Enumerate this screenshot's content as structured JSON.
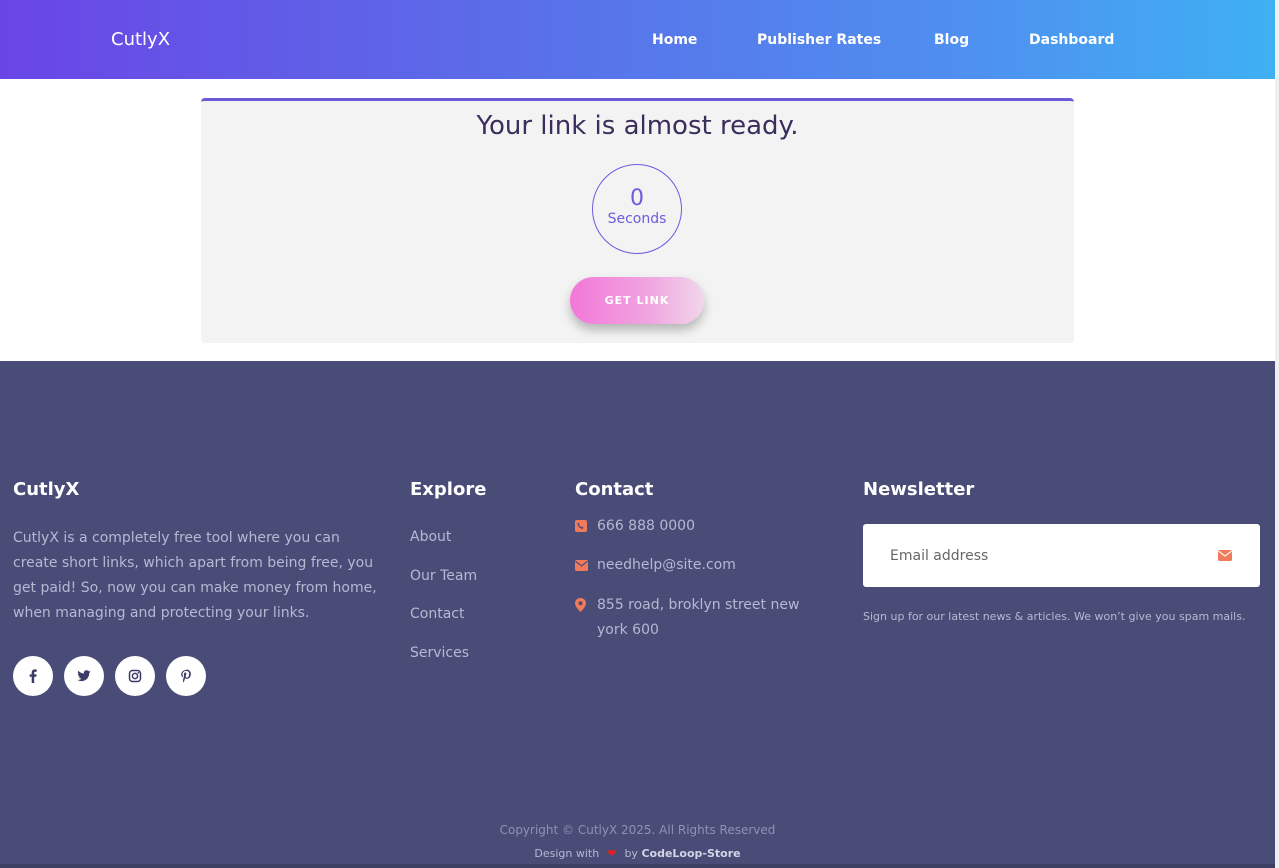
{
  "header": {
    "brand": "CutlyX",
    "nav": [
      "Home",
      "Publisher Rates",
      "Blog",
      "Dashboard"
    ]
  },
  "main": {
    "title": "Your link is almost ready.",
    "countdown_value": "0",
    "countdown_unit": "Seconds",
    "button_label": "GET LINK"
  },
  "footer": {
    "about": {
      "title": "CutlyX",
      "text": "CutlyX is a completely free tool where you can create short links, which apart from being free, you get paid! So, now you can make money from home, when managing and protecting your links.",
      "socials": [
        "facebook-icon",
        "twitter-icon",
        "instagram-icon",
        "pinterest-icon"
      ]
    },
    "explore": {
      "title": "Explore",
      "links": [
        "About",
        "Our Team",
        "Contact",
        "Services"
      ]
    },
    "contact": {
      "title": "Contact",
      "phone": "666 888 0000",
      "email": "needhelp@site.com",
      "address": "855 road, broklyn street new york 600"
    },
    "newsletter": {
      "title": "Newsletter",
      "placeholder": "Email address",
      "note": "Sign up for our latest news & articles. We won’t give you spam mails."
    },
    "copyright": "Copyright © CutlyX 2025. All Rights Reserved",
    "design_with": "Design with",
    "design_by": "by",
    "design_by_name": "CodeLoop-Store"
  },
  "colors": {
    "header_gradient_start": "#6a45e6",
    "header_gradient_end": "#3fb0f3",
    "footer_bg": "#4a4c78",
    "accent": "#6b5ce0",
    "button_pink": "#f377d8",
    "contact_icon": "#f07a5a"
  }
}
